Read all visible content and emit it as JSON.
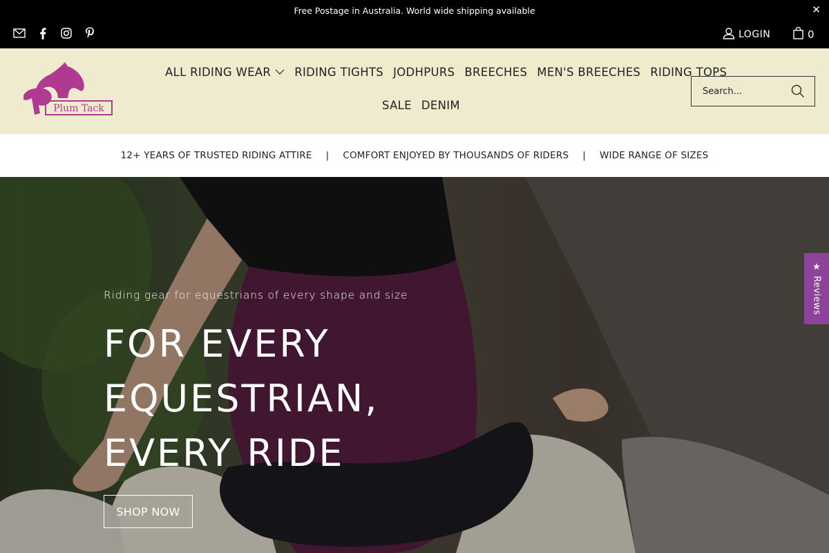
{
  "announcement": {
    "text": "Free Postage in Australia. World wide shipping available",
    "close_icon": "close-icon"
  },
  "social": [
    {
      "name": "email-icon"
    },
    {
      "name": "facebook-icon"
    },
    {
      "name": "instagram-icon"
    },
    {
      "name": "pinterest-icon"
    }
  ],
  "account": {
    "login_label": "LOGIN",
    "cart_count": "0"
  },
  "logo": {
    "text": "Plum Tack",
    "color": "#b03a8f"
  },
  "nav": {
    "row1": [
      "ALL RIDING WEAR",
      "RIDING TIGHTS",
      "JODHPURS",
      "BREECHES",
      "MEN'S BREECHES",
      "RIDING TOPS"
    ],
    "row2": [
      "SALE",
      "DENIM"
    ]
  },
  "search": {
    "placeholder": "Search..."
  },
  "trust": {
    "item1": "12+ YEARS OF TRUSTED RIDING ATTIRE",
    "item2": "COMFORT ENJOYED BY THOUSANDS OF RIDERS",
    "item3": "WIDE RANGE OF SIZES",
    "separator": "|"
  },
  "hero": {
    "subtitle": "Riding gear for equestrians of every shape and size",
    "title_line1": "FOR EVERY",
    "title_line2": "EQUESTRIAN,",
    "title_line3": "EVERY RIDE",
    "cta": "SHOP NOW"
  },
  "reviews_tab": {
    "label": "★ Reviews",
    "color": "#8c4399"
  },
  "colors": {
    "header_bg": "#efebcf",
    "topbar_bg": "#000000",
    "accent": "#8c4399"
  }
}
